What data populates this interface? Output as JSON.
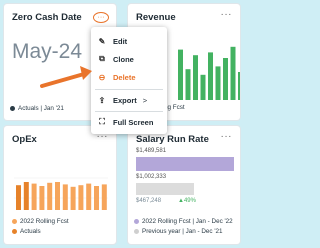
{
  "cards": {
    "zero_cash": {
      "title": "Zero Cash Date",
      "value": "May-24",
      "legend": "Actuals | Jan '21",
      "menu_icon": "ellipsis-icon"
    },
    "revenue": {
      "title": "Revenue",
      "legend": "2022 Rolling Fcst",
      "bars": [
        0.9,
        0.55,
        0.8,
        0.45,
        0.85,
        0.6,
        0.75,
        0.95,
        0.5,
        0.7
      ],
      "bar_color": "#43b261"
    },
    "opex": {
      "title": "OpEx",
      "legend": [
        "2022 Rolling Fcst",
        "Actuals"
      ],
      "colors": {
        "fcst": "#f6a55b",
        "actuals": "#e6822a"
      },
      "bars": [
        0.62,
        0.7,
        0.66,
        0.6,
        0.68,
        0.7,
        0.64,
        0.58,
        0.62,
        0.66,
        0.6,
        0.64
      ]
    },
    "salary": {
      "title": "Salary Run Rate",
      "values": [
        "$1,489,581",
        "$1,002,333",
        "$467,248"
      ],
      "change": "49%",
      "legend": [
        "2022 Rolling Fcst | Jan - Dec '22",
        "Previous year | Jan - Dec '21"
      ],
      "colors": {
        "fcst": "#b3a7d9",
        "previous": "#dcdcdc"
      }
    }
  },
  "menu": {
    "items": [
      {
        "label": "Edit",
        "icon": "pencil-icon"
      },
      {
        "label": "Clone",
        "icon": "clone-icon"
      },
      {
        "label": "Delete",
        "icon": "minus-circle-icon"
      },
      {
        "label": "Export",
        "icon": "export-icon",
        "chevron": ">"
      },
      {
        "label": "Full Screen",
        "icon": "fullscreen-icon"
      }
    ]
  },
  "colors": {
    "accent": "#e9742b",
    "background": "#cfeef5"
  }
}
